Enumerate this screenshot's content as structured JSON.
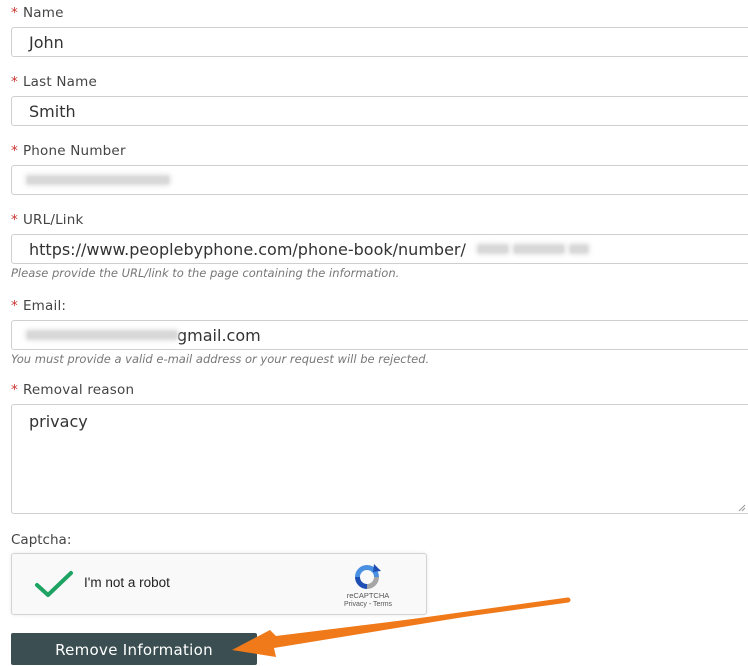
{
  "colors": {
    "required": "#c9302c",
    "button": "#3b4f52",
    "arrow": "#f07a1a",
    "check": "#1ea362"
  },
  "fields": {
    "name": {
      "required_mark": "*",
      "label": "Name",
      "value": "John"
    },
    "last_name": {
      "required_mark": "*",
      "label": "Last Name",
      "value": "Smith"
    },
    "phone": {
      "required_mark": "*",
      "label": "Phone Number",
      "value": ""
    },
    "url": {
      "required_mark": "*",
      "label": "URL/Link",
      "value": "https://www.peoplebyphone.com/phone-book/number/",
      "hint": "Please provide the URL/link to the page containing the information."
    },
    "email": {
      "required_mark": "*",
      "label": "Email:",
      "value": "gmail.com",
      "hint": "You must provide a valid e-mail address or your request will be rejected."
    },
    "reason": {
      "required_mark": "*",
      "label": "Removal reason",
      "value": "privacy"
    }
  },
  "captcha": {
    "label": "Captcha:",
    "checkbox_text": "I'm not a robot",
    "checked": true,
    "brand": "reCAPTCHA",
    "privacy": "Privacy",
    "separator": " - ",
    "terms": "Terms",
    "icons": {
      "check": "checkmark-icon",
      "logo": "recaptcha-logo-icon"
    }
  },
  "submit": {
    "label": "Remove Information"
  },
  "annotation": {
    "icon": "arrow-icon"
  }
}
